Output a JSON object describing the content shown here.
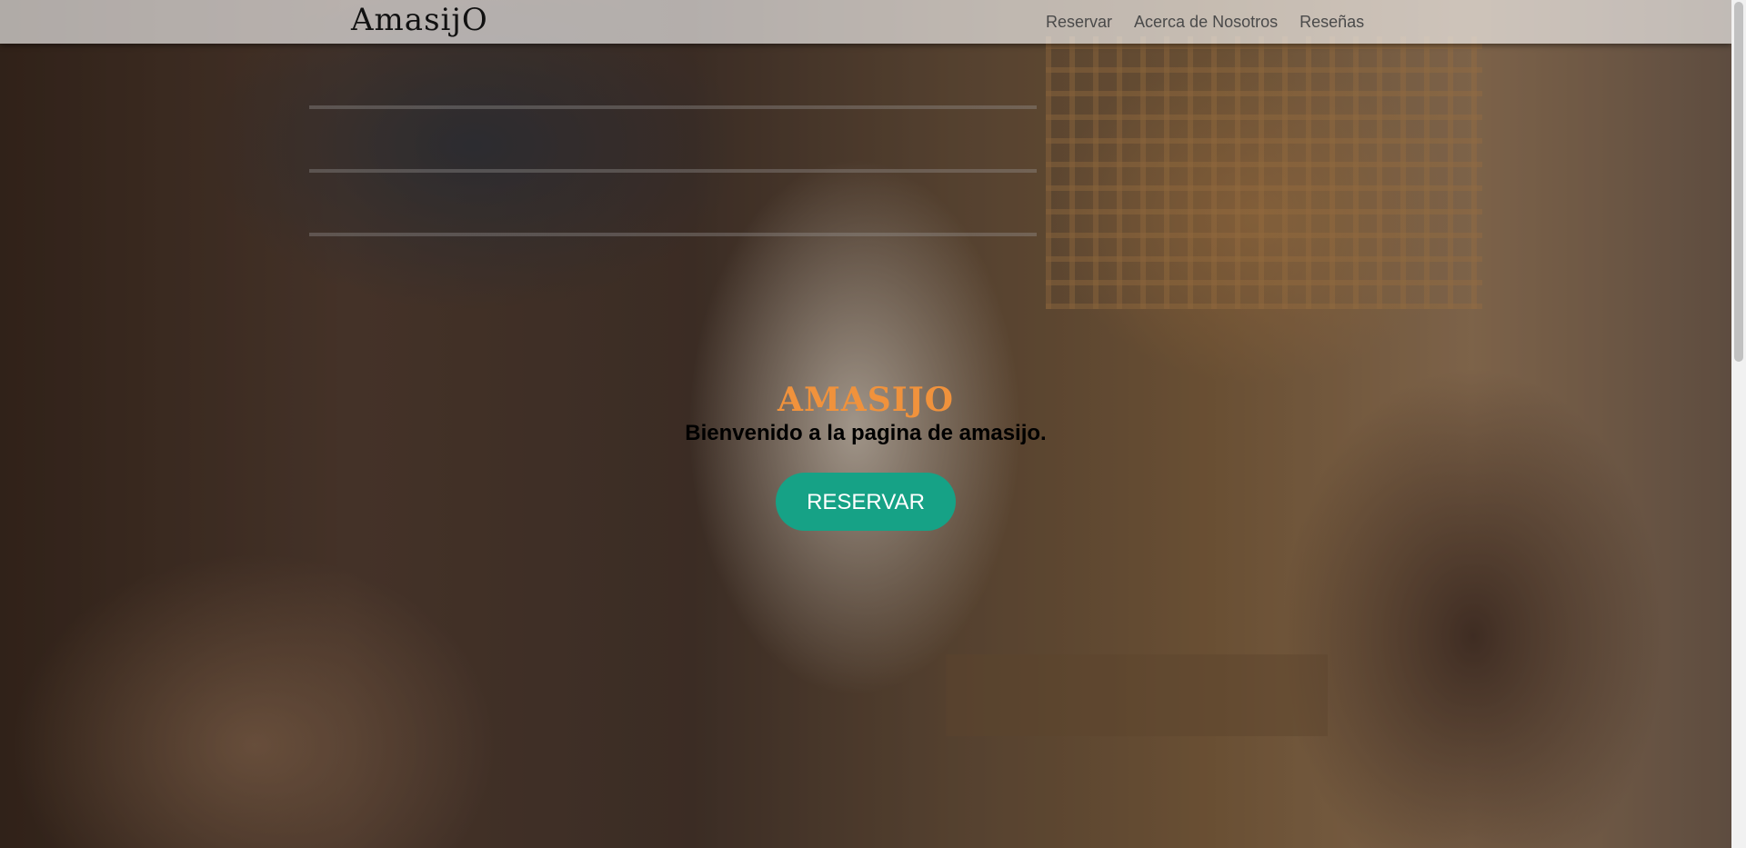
{
  "navbar": {
    "brand": "AmasijO",
    "links": [
      {
        "label": "Reservar"
      },
      {
        "label": "Acerca de Nosotros"
      },
      {
        "label": "Reseñas"
      }
    ]
  },
  "hero": {
    "title": "AMASIJO",
    "subtitle": "Bienvenido a la pagina de amasijo.",
    "button_label": "RESERVAR"
  },
  "colors": {
    "accent_title": "#f0923c",
    "button_bg": "#16a286",
    "navbar_bg": "#ffffffa0"
  }
}
